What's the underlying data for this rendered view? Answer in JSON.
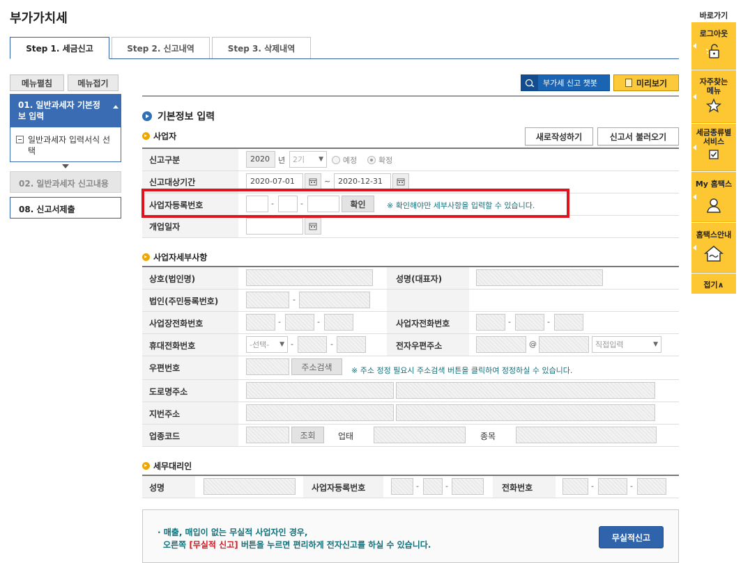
{
  "page_title": "부가가치세",
  "tabs": [
    "Step 1. 세금신고",
    "Step 2. 신고내역",
    "Step 3. 삭제내역"
  ],
  "left": {
    "expand": "메뉴펼침",
    "collapse": "메뉴접기",
    "step1": "01. 일반과세자 기본정보 입력",
    "step1_sub": "일반과세자 입력서식 선택",
    "step2": "02. 일반과세자 신고내용",
    "step3": "08. 신고서제출"
  },
  "toolbar": {
    "chatbot": "부가세 신고 챗봇",
    "preview": "미리보기"
  },
  "section_title": "기본정보 입력",
  "business": {
    "heading": "사업자",
    "new_btn": "새로작성하기",
    "load_btn": "신고서 불러오기",
    "report_type_label": "신고구분",
    "year": "2020",
    "year_unit": "년",
    "period": "2기",
    "radio_expected": "예정",
    "radio_final": "확정",
    "target_period_label": "신고대상기간",
    "date_from": "2020-07-01",
    "tilde": "~",
    "date_to": "2020-12-31",
    "reg_no_label": "사업자등록번호",
    "confirm_btn": "확인",
    "reg_note": "※ 확인해야만 세부사항을 입력할 수 있습니다.",
    "open_date_label": "개업일자"
  },
  "details": {
    "heading": "사업자세부사항",
    "trade_name": "상호(법인명)",
    "rep_name": "성명(대표자)",
    "corp_no": "법인(주민등록번호)",
    "office_phone": "사업장전화번호",
    "biz_phone": "사업자전화번호",
    "mobile": "휴대전화번호",
    "mobile_select": "-선택-",
    "email": "전자우편주소",
    "at": "@",
    "email_domain": "직접입력",
    "postal": "우편번호",
    "addr_search": "주소검색",
    "postal_note": "※ 주소 정정 필요시 주소검색 버튼을 클릭하여 정정하실 수 있습니다.",
    "road_addr": "도로명주소",
    "lot_addr": "지번주소",
    "industry_code": "업종코드",
    "lookup": "조회",
    "biz_type": "업태",
    "biz_item": "종목"
  },
  "agent": {
    "heading": "세무대리인",
    "name": "성명",
    "reg_no": "사업자등록번호",
    "phone": "전화번호"
  },
  "notice": {
    "line1": "· 매출, 매입이 없는 무실적 사업자인 경우,",
    "line2_pre": "오른쪽 ",
    "line2_em": "[무실적 신고]",
    "line2_post": " 버튼을 누르면 편리하게 전자신고를 하실 수 있습니다.",
    "button": "무실적신고"
  },
  "quick": {
    "title": "바로가기",
    "logout": "로그아웃",
    "faq": "자주찾는 메뉴",
    "service": "세금종류별 서비스",
    "my": "My 홈택스",
    "guide": "홈택스안내",
    "fold": "접기∧"
  },
  "colors": {
    "accent_blue": "#3b6db3",
    "highlight_red": "#e0141e",
    "quick_yellow": "#fcc732",
    "note_green": "#11707a"
  }
}
